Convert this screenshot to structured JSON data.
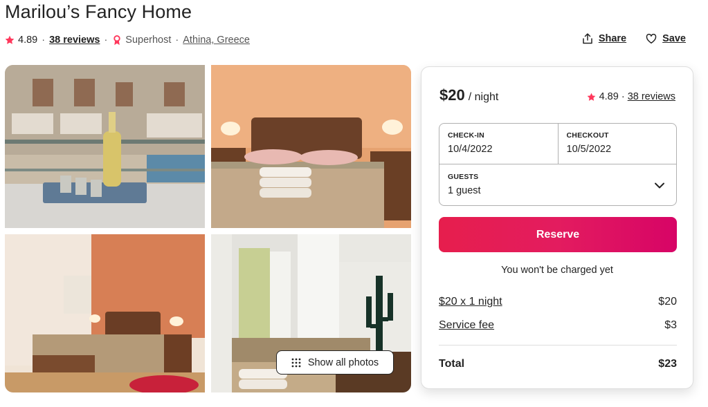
{
  "listing": {
    "title": "Marilou’s Fancy Home",
    "rating": "4.89",
    "reviews": "38 reviews",
    "superhost": "Superhost",
    "location": "Athina, Greece"
  },
  "actions": {
    "share": "Share",
    "save": "Save"
  },
  "gallery": {
    "show_all": "Show all photos"
  },
  "booking": {
    "price": "$20",
    "per": "/ night",
    "rating": "4.89",
    "reviews": "38 reviews",
    "checkin_label": "CHECK-IN",
    "checkin_value": "10/4/2022",
    "checkout_label": "CHECKOUT",
    "checkout_value": "10/5/2022",
    "guests_label": "GUESTS",
    "guests_value": "1 guest",
    "reserve": "Reserve",
    "note": "You won't be charged yet",
    "line1_label": "$20 x 1 night",
    "line1_value": "$20",
    "line2_label": "Service fee",
    "line2_value": "$3",
    "total_label": "Total",
    "total_value": "$23"
  },
  "colors": {
    "accent": "#e31c5f",
    "star": "#ff385c",
    "text": "#222222",
    "muted": "#717171",
    "border": "#dddddd"
  },
  "icons": [
    "star-icon",
    "superhost-icon",
    "share-icon",
    "heart-icon",
    "grid-dots-icon",
    "chevron-down-icon"
  ]
}
